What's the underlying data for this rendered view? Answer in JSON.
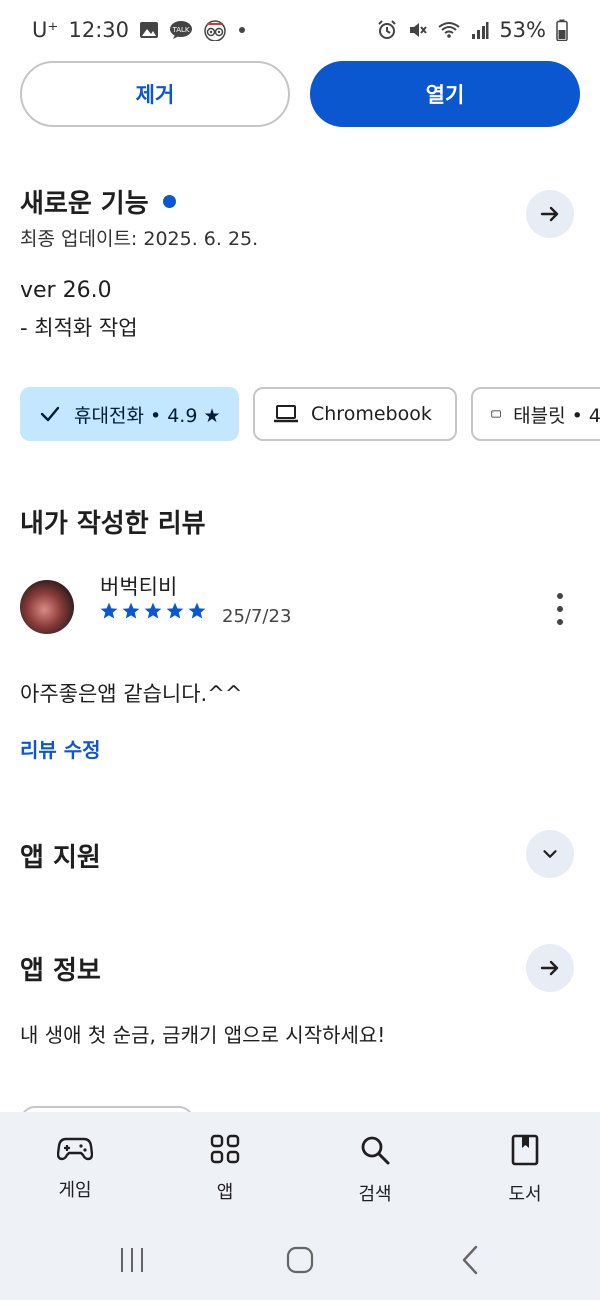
{
  "status_bar": {
    "carrier": "U⁺",
    "time": "12:30",
    "battery": "53%",
    "icons": [
      "gallery-icon",
      "talk-icon",
      "tripadvisor-icon",
      "dot-icon",
      "alarm-icon",
      "mute-icon",
      "wifi-icon",
      "signal-icon",
      "battery-icon"
    ]
  },
  "actions": {
    "remove_label": "제거",
    "open_label": "열기"
  },
  "whats_new": {
    "title": "새로운 기능",
    "updated": "최종 업데이트: 2025. 6. 25.",
    "version": "ver 26.0",
    "notes": "- 최적화 작업"
  },
  "device_chips": [
    {
      "label": "휴대전화 • 4.9 ★",
      "icon": "check-icon",
      "selected": true
    },
    {
      "label": "Chromebook",
      "icon": "laptop-icon",
      "selected": false
    },
    {
      "label": "태블릿 • 4",
      "icon": "tablet-icon",
      "selected": false
    }
  ],
  "my_review": {
    "title": "내가 작성한 리뷰",
    "reviewer": "버벅티비",
    "rating": 5,
    "date": "25/7/23",
    "text": "아주좋은앱 같습니다.^^",
    "edit_label": "리뷰 수정"
  },
  "app_support": {
    "title": "앱 지원"
  },
  "app_info": {
    "title": "앱 정보",
    "description": "내 생애 첫 순금, 금캐기 앱으로 시작하세요!"
  },
  "bottom_nav": [
    {
      "label": "게임",
      "icon": "gamepad-icon"
    },
    {
      "label": "앱",
      "icon": "apps-icon"
    },
    {
      "label": "검색",
      "icon": "search-icon"
    },
    {
      "label": "도서",
      "icon": "book-icon"
    }
  ],
  "colors": {
    "accent": "#0b57d0",
    "chip_selected": "#c2e7ff",
    "nav_background": "#eef1f6"
  }
}
